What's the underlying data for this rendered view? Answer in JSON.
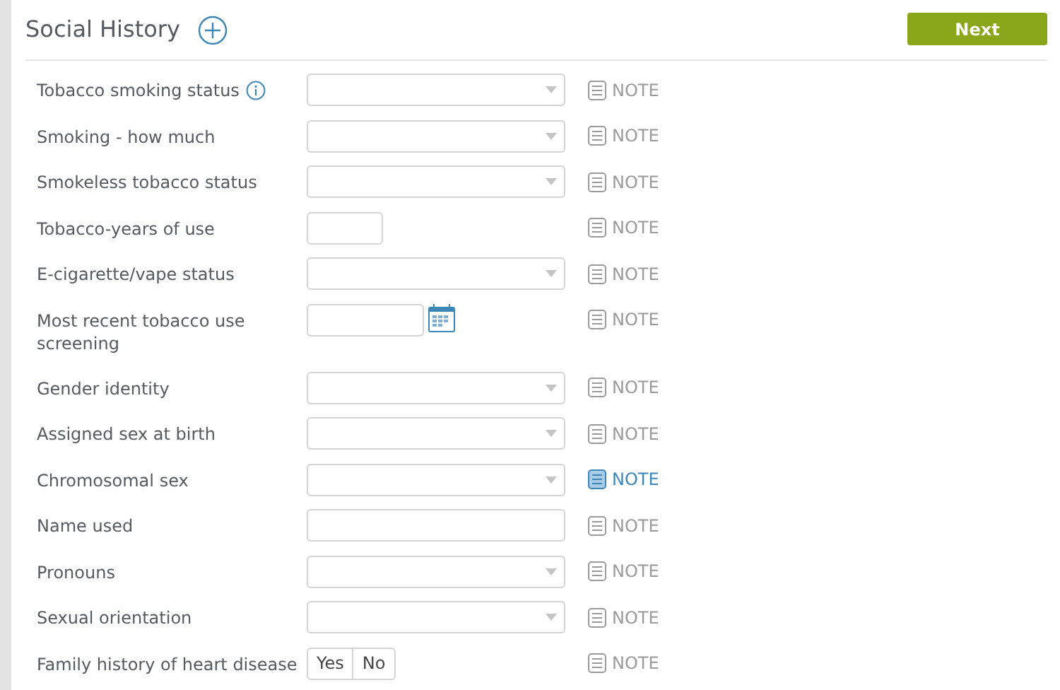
{
  "header": {
    "title": "Social History",
    "next_button": "Next"
  },
  "rows": [
    {
      "label": "Tobacco smoking status",
      "info": true,
      "kind": "select",
      "note": "NOTE",
      "note_hover": false
    },
    {
      "label": "Smoking - how much",
      "kind": "select",
      "note": "NOTE",
      "note_hover": false
    },
    {
      "label": "Smokeless tobacco status",
      "kind": "select",
      "note": "NOTE",
      "note_hover": false
    },
    {
      "label": "Tobacco-years of use",
      "kind": "short",
      "note": "NOTE",
      "note_hover": false
    },
    {
      "label": "E-cigarette/vape status",
      "kind": "select",
      "note": "NOTE",
      "note_hover": false
    },
    {
      "label": "Most recent tobacco use screening",
      "kind": "date",
      "note": "NOTE",
      "note_hover": false
    },
    {
      "label": "Gender identity",
      "kind": "select",
      "note": "NOTE",
      "note_hover": false
    },
    {
      "label": "Assigned sex at birth",
      "kind": "select",
      "note": "NOTE",
      "note_hover": false
    },
    {
      "label": "Chromosomal sex",
      "kind": "select",
      "note": "NOTE",
      "note_hover": true
    },
    {
      "label": "Name used",
      "kind": "text",
      "note": "NOTE",
      "note_hover": false
    },
    {
      "label": "Pronouns",
      "kind": "select",
      "note": "NOTE",
      "note_hover": false
    },
    {
      "label": "Sexual orientation",
      "kind": "select",
      "note": "NOTE",
      "note_hover": false
    },
    {
      "label": "Family history of heart disease",
      "kind": "yesno",
      "options": [
        "Yes",
        "No"
      ],
      "note": "NOTE",
      "note_hover": false
    }
  ]
}
